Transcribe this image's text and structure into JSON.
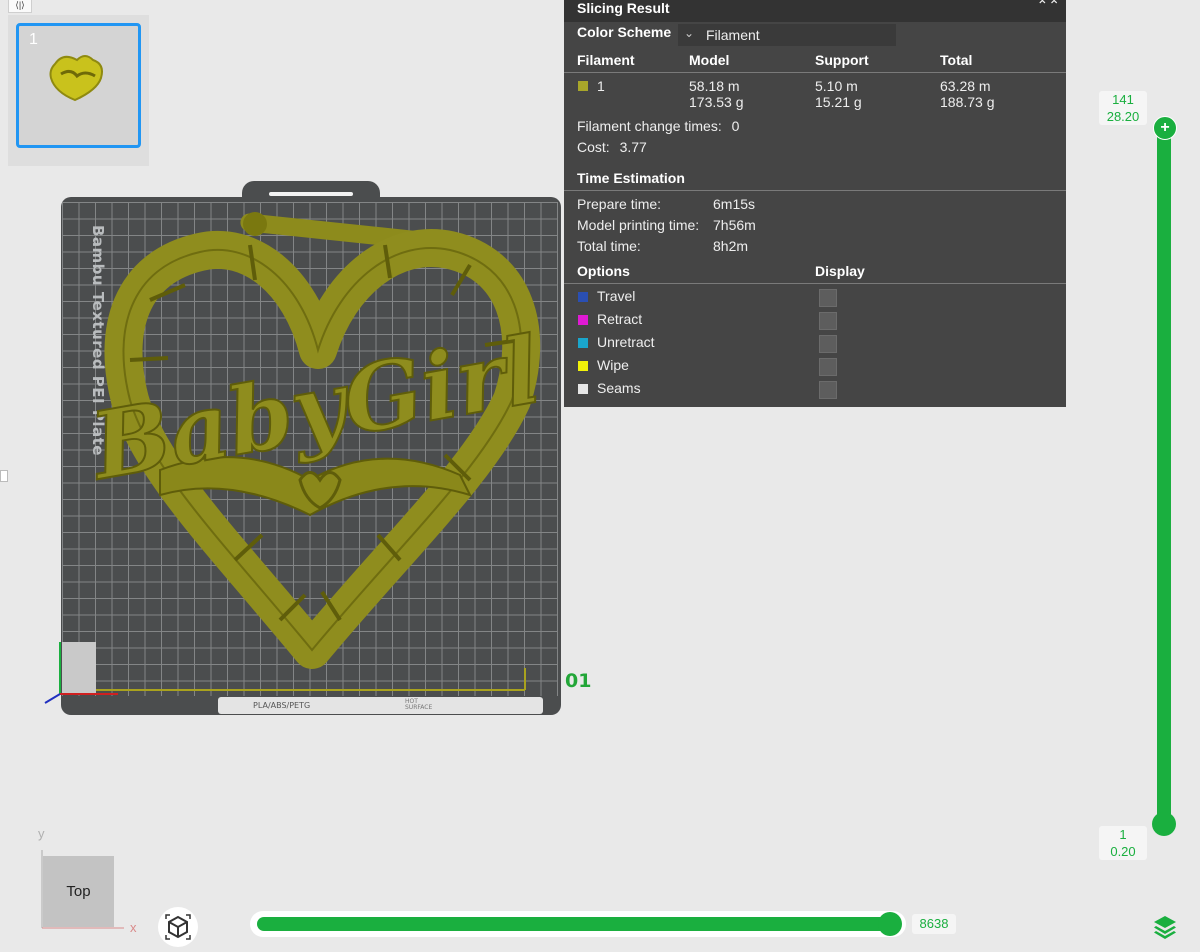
{
  "thumbnail": {
    "plate_number": "1"
  },
  "plate": {
    "label": "Bambu Textured PEI Plate",
    "bottom_text": "PLA/ABS/PETG",
    "hot_surface_text": "HOT SURFACE",
    "number": "01",
    "model_text": "BabyGirl"
  },
  "result": {
    "title": "Slicing Result",
    "color_scheme_label": "Color Scheme",
    "color_scheme_value": "Filament",
    "headers": {
      "filament": "Filament",
      "model": "Model",
      "support": "Support",
      "total": "Total"
    },
    "filament_row": {
      "id": "1",
      "color": "#a8a62a",
      "model_length": "58.18 m",
      "model_weight": "173.53 g",
      "support_length": "5.10 m",
      "support_weight": "15.21 g",
      "total_length": "63.28 m",
      "total_weight": "188.73 g"
    },
    "filament_change_label": "Filament change times:",
    "filament_change_value": "0",
    "cost_label": "Cost:",
    "cost_value": "3.77",
    "time_title": "Time Estimation",
    "prepare_label": "Prepare time:",
    "prepare_value": "6m15s",
    "model_time_label": "Model printing time:",
    "model_time_value": "7h56m",
    "total_time_label": "Total time:",
    "total_time_value": "8h2m",
    "options_label": "Options",
    "display_label": "Display",
    "options": [
      {
        "label": "Travel",
        "color": "#2a4fb3"
      },
      {
        "label": "Retract",
        "color": "#e01ad4"
      },
      {
        "label": "Unretract",
        "color": "#1aa6cc"
      },
      {
        "label": "Wipe",
        "color": "#f2f20a"
      },
      {
        "label": "Seams",
        "color": "#e6e6e6"
      }
    ]
  },
  "layer_slider": {
    "top_layer": "141",
    "top_height": "28.20",
    "bottom_layer": "1",
    "bottom_height": "0.20"
  },
  "move_slider": {
    "value": "8638"
  },
  "view": {
    "cube_label": "Top",
    "axis_y": "y",
    "axis_x": "x"
  },
  "colors": {
    "accent_green": "#1aaf3f",
    "model_color": "#8f8d1e",
    "plate_color": "#4b4d4e"
  }
}
